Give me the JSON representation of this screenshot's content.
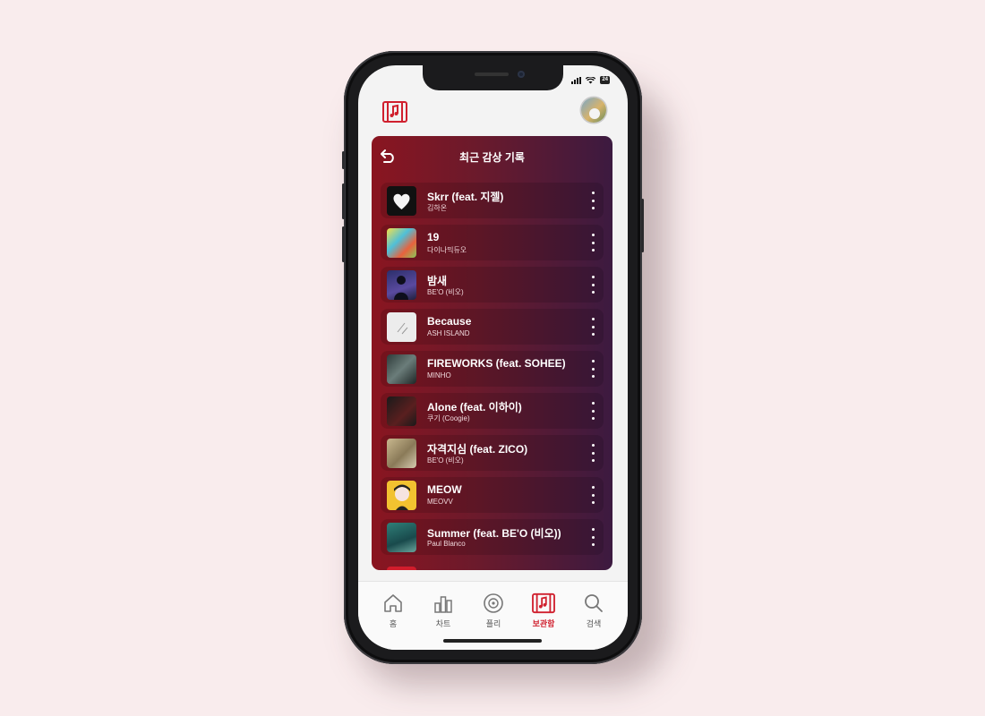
{
  "colors": {
    "brand": "#d0202e",
    "background": "#f9eced",
    "card_gradient_start": "#8a1520",
    "card_gradient_end": "#3c1a40"
  },
  "status_bar": {
    "battery": "24"
  },
  "app": {
    "logo_icon": "music-library-icon"
  },
  "card": {
    "back_icon": "back-arrow-icon",
    "title": "최근 감상 기록"
  },
  "tracks": [
    {
      "title": "Skrr (feat. 지젤)",
      "artist": "김하온",
      "more_icon": "more-vertical-icon"
    },
    {
      "title": "19",
      "artist": "다이나믹듀오",
      "more_icon": "more-vertical-icon"
    },
    {
      "title": "밤새",
      "artist": "BE'O (비오)",
      "more_icon": "more-vertical-icon"
    },
    {
      "title": "Because",
      "artist": "ASH ISLAND",
      "more_icon": "more-vertical-icon"
    },
    {
      "title": "FIREWORKS (feat. SOHEE)",
      "artist": "MINHO",
      "more_icon": "more-vertical-icon"
    },
    {
      "title": "Alone (feat. 이하이)",
      "artist": "쿠기 (Coogie)",
      "more_icon": "more-vertical-icon"
    },
    {
      "title": "자격지심 (feat. ZICO)",
      "artist": "BE'O (비오)",
      "more_icon": "more-vertical-icon"
    },
    {
      "title": "MEOW",
      "artist": "MEOVV",
      "more_icon": "more-vertical-icon"
    },
    {
      "title": "Summer (feat. BE'O (비오))",
      "artist": "Paul Blanco",
      "more_icon": "more-vertical-icon"
    }
  ],
  "nav": {
    "items": [
      {
        "label": "홈",
        "icon": "home-icon"
      },
      {
        "label": "차트",
        "icon": "chart-icon"
      },
      {
        "label": "플리",
        "icon": "disc-icon"
      },
      {
        "label": "보관함",
        "icon": "music-library-icon",
        "active": true
      },
      {
        "label": "검색",
        "icon": "search-icon"
      }
    ]
  }
}
